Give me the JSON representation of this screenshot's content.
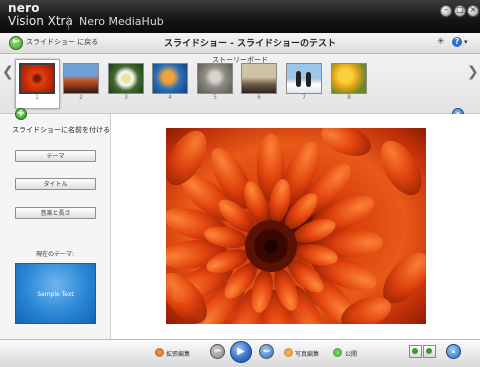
{
  "window": {
    "brand_top": "nero",
    "brand_app": "Vision Xtra",
    "hub": "Nero MediaHub",
    "minimize": "–",
    "maximize": "□",
    "close": "×"
  },
  "toolbar": {
    "back_label": "スライドショー に戻る",
    "title": "スライドショー - スライドショーのテスト",
    "help_caret": "▾"
  },
  "storyboard": {
    "label": "ストーリーボード",
    "prev": "❮",
    "next": "❯",
    "thumbnails": [
      {
        "num": "1",
        "selected": true
      },
      {
        "num": "2"
      },
      {
        "num": "3"
      },
      {
        "num": "4"
      },
      {
        "num": "5"
      },
      {
        "num": "6"
      },
      {
        "num": "7"
      },
      {
        "num": "8"
      }
    ]
  },
  "sidebar": {
    "heading": "スライドショーに名前を付ける",
    "buttons": {
      "theme": "テーマ",
      "title": "タイトル",
      "music_length": "音楽と長さ"
    },
    "current_theme_label": "現在のテーマ:",
    "preview_text": "Sample Text"
  },
  "bottom": {
    "extended_edit": "拡張編集",
    "photo_edit": "写真編集",
    "publish": "公開"
  },
  "icons": {
    "add": "+",
    "back": "←",
    "help": "?",
    "tools": "✳"
  },
  "colors": {
    "accent_green": "#3a9a2a",
    "accent_blue": "#2f6cc2",
    "theme_blue": "#2a87d6"
  }
}
